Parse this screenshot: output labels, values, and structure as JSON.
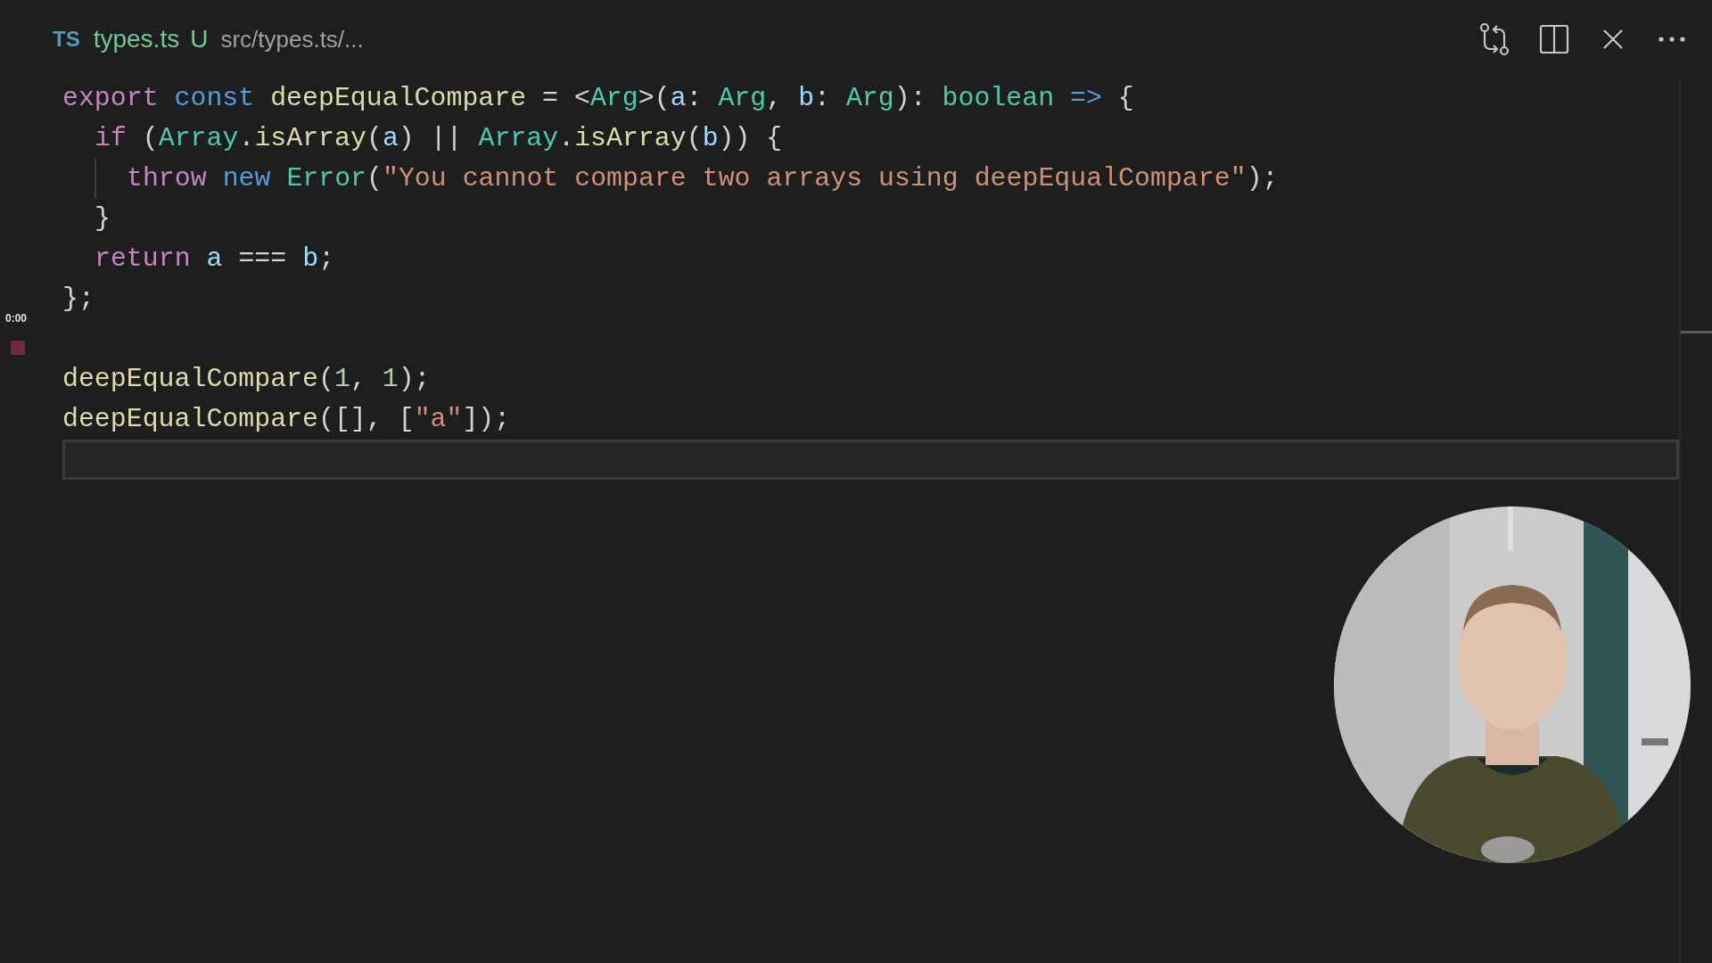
{
  "tab": {
    "language_badge": "TS",
    "filename": "types.ts",
    "git_status": "U",
    "path": "src/types.ts/..."
  },
  "toolbar": [
    {
      "kind": "compare"
    },
    {
      "kind": "split"
    },
    {
      "kind": "close"
    },
    {
      "kind": "more"
    }
  ],
  "recorder": {
    "time": "0:00"
  },
  "code_lines": [
    {
      "tokens": [
        {
          "kind": "keyword",
          "text": "export "
        },
        {
          "kind": "storage",
          "text": "const "
        },
        {
          "kind": "function",
          "text": "deepEqualCompare"
        },
        {
          "kind": "plain",
          "text": " = <"
        },
        {
          "kind": "type",
          "text": "Arg"
        },
        {
          "kind": "plain",
          "text": ">("
        },
        {
          "kind": "variable",
          "text": "a"
        },
        {
          "kind": "plain",
          "text": ": "
        },
        {
          "kind": "type",
          "text": "Arg"
        },
        {
          "kind": "plain",
          "text": ", "
        },
        {
          "kind": "variable",
          "text": "b"
        },
        {
          "kind": "plain",
          "text": ": "
        },
        {
          "kind": "type",
          "text": "Arg"
        },
        {
          "kind": "plain",
          "text": "): "
        },
        {
          "kind": "type",
          "text": "boolean "
        },
        {
          "kind": "storage",
          "text": "=>"
        },
        {
          "kind": "plain",
          "text": " {"
        }
      ],
      "children": [
        {
          "tokens": [
            {
              "kind": "keyword",
              "text": "if"
            },
            {
              "kind": "plain",
              "text": " ("
            },
            {
              "kind": "type",
              "text": "Array"
            },
            {
              "kind": "plain",
              "text": "."
            },
            {
              "kind": "function",
              "text": "isArray"
            },
            {
              "kind": "plain",
              "text": "("
            },
            {
              "kind": "variable",
              "text": "a"
            },
            {
              "kind": "plain",
              "text": ") || "
            },
            {
              "kind": "type",
              "text": "Array"
            },
            {
              "kind": "plain",
              "text": "."
            },
            {
              "kind": "function",
              "text": "isArray"
            },
            {
              "kind": "plain",
              "text": "("
            },
            {
              "kind": "variable",
              "text": "b"
            },
            {
              "kind": "plain",
              "text": ")) {"
            }
          ],
          "children": [
            {
              "tokens": [
                {
                  "kind": "keyword",
                  "text": "throw "
                },
                {
                  "kind": "storage",
                  "text": "new "
                },
                {
                  "kind": "type",
                  "text": "Error"
                },
                {
                  "kind": "plain",
                  "text": "("
                },
                {
                  "kind": "string",
                  "text": "\"You cannot compare two arrays using deepEqualCompare\""
                },
                {
                  "kind": "plain",
                  "text": ");"
                }
              ]
            }
          ]
        },
        {
          "tokens": [
            {
              "kind": "plain",
              "text": "}"
            }
          ]
        },
        {
          "tokens": [
            {
              "kind": "keyword",
              "text": "return "
            },
            {
              "kind": "variable",
              "text": "a"
            },
            {
              "kind": "plain",
              "text": " === "
            },
            {
              "kind": "variable",
              "text": "b"
            },
            {
              "kind": "plain",
              "text": ";"
            }
          ]
        }
      ]
    },
    {
      "tokens": [
        {
          "kind": "plain",
          "text": "};"
        }
      ]
    },
    {
      "current": false
    },
    {
      "tokens": [
        {
          "kind": "function",
          "text": "deepEqualCompare"
        },
        {
          "kind": "plain",
          "text": "("
        },
        {
          "kind": "number",
          "text": "1"
        },
        {
          "kind": "plain",
          "text": ", "
        },
        {
          "kind": "number",
          "text": "1"
        },
        {
          "kind": "plain",
          "text": ");"
        }
      ]
    },
    {
      "tokens": [
        {
          "kind": "function",
          "text": "deepEqualCompare"
        },
        {
          "kind": "plain",
          "text": "([], ["
        },
        {
          "kind": "string",
          "text": "\"a\""
        },
        {
          "kind": "plain",
          "text": "]);"
        }
      ]
    },
    {
      "current": true
    }
  ]
}
